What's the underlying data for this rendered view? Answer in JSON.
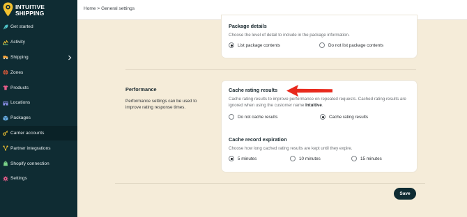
{
  "brand": {
    "name_line1": "INTUITIVE",
    "name_line2": "SHIPPING"
  },
  "sidebar": {
    "items": [
      {
        "label": "Get started",
        "icon": "rocket-icon"
      },
      {
        "label": "Activity",
        "icon": "activity-icon"
      },
      {
        "label": "Shipping",
        "icon": "truck-icon",
        "has_submenu": true
      },
      {
        "label": "Zones",
        "icon": "globe-icon"
      },
      {
        "label": "Products",
        "icon": "shirt-icon"
      },
      {
        "label": "Locations",
        "icon": "building-icon"
      },
      {
        "label": "Packages",
        "icon": "box-icon"
      },
      {
        "label": "Carrier accounts",
        "icon": "key-icon",
        "active": true
      },
      {
        "label": "Partner integrations",
        "icon": "network-icon"
      },
      {
        "label": "Shopify connection",
        "icon": "shopify-icon"
      },
      {
        "label": "Settings",
        "icon": "gear-icon"
      }
    ]
  },
  "header": {
    "breadcrumb": "Home > General settings"
  },
  "package_details": {
    "title": "Package details",
    "description": "Choose the level of detail to include in the package information.",
    "options": [
      {
        "label": "List package contents",
        "checked": true
      },
      {
        "label": "Do not list package contents",
        "checked": false
      }
    ]
  },
  "performance": {
    "section_title": "Performance",
    "section_description": "Performance settings can be used to improve rating response times.",
    "cache_title": "Cache rating results",
    "cache_description_prefix": "Cache rating results to improve performance on repeated requests. Cached rating results are ignored when using the customer name ",
    "cache_description_bold": "Intuitive",
    "cache_description_suffix": ".",
    "cache_options": [
      {
        "label": "Do not cache results",
        "checked": false
      },
      {
        "label": "Cache rating results",
        "checked": true
      }
    ],
    "expiration_title": "Cache record expiration",
    "expiration_description": "Choose how long cached rating results are kept until they expire.",
    "expiration_options": [
      {
        "label": "5 minutes",
        "checked": true
      },
      {
        "label": "10 minutes",
        "checked": false
      },
      {
        "label": "15 minutes",
        "checked": false
      }
    ]
  },
  "footer": {
    "save_label": "Save"
  },
  "colors": {
    "sidebar": "#0f2c33",
    "background": "#f5ecd9",
    "accent_arrow": "#e8291c",
    "brand_yellow": "#f2c230"
  }
}
